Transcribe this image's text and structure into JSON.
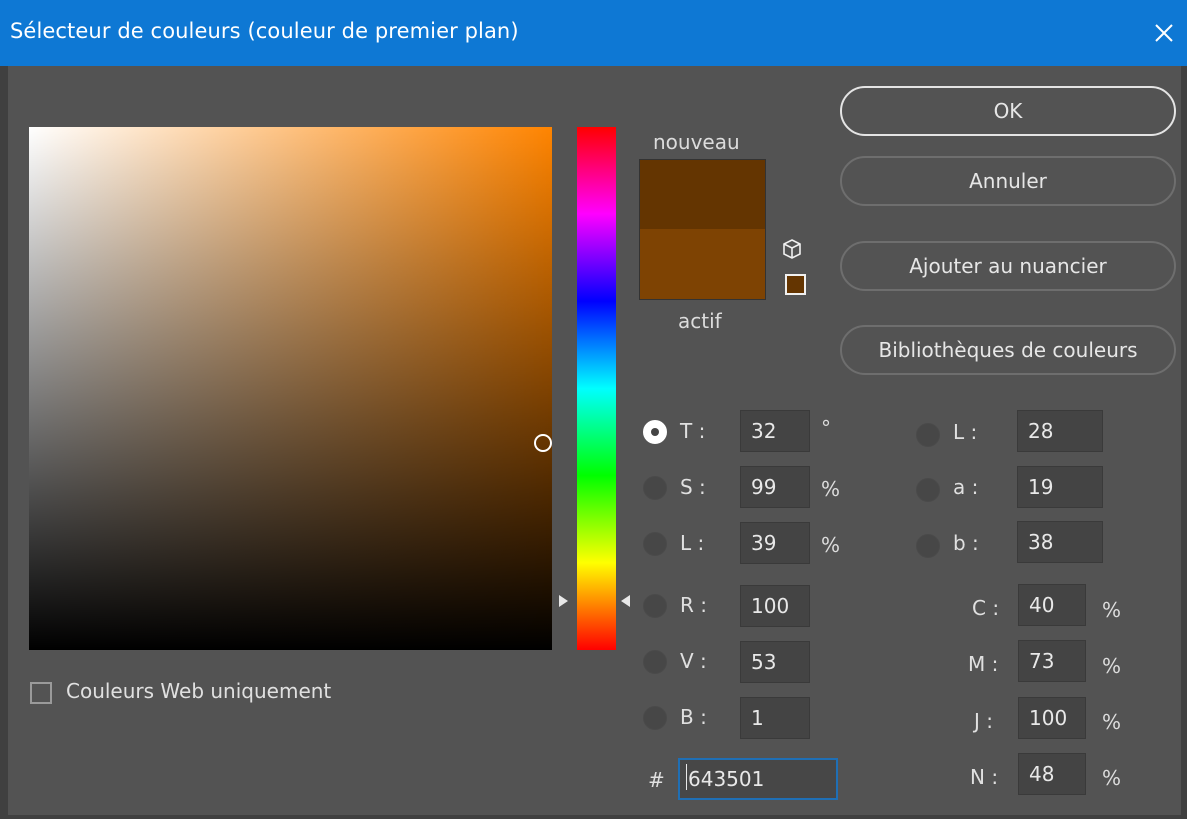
{
  "window": {
    "title": "Sélecteur de couleurs (couleur de premier plan)"
  },
  "buttons": {
    "ok": "OK",
    "cancel": "Annuler",
    "add_swatch": "Ajouter au nuancier",
    "libraries": "Bibliothèques de couleurs"
  },
  "swatch": {
    "new_label": "nouveau",
    "current_label": "actif",
    "new_color": "#643501",
    "current_color": "#7e4303"
  },
  "web_only": {
    "label": "Couleurs Web uniquement",
    "checked": false
  },
  "hsb": {
    "selected": "T",
    "fields": [
      {
        "label": "T :",
        "value": "32",
        "unit": "°"
      },
      {
        "label": "S :",
        "value": "99",
        "unit": "%"
      },
      {
        "label": "L :",
        "value": "39",
        "unit": "%"
      }
    ]
  },
  "rgb": {
    "fields": [
      {
        "label": "R :",
        "value": "100"
      },
      {
        "label": "V :",
        "value": "53"
      },
      {
        "label": "B :",
        "value": "1"
      }
    ]
  },
  "lab": {
    "fields": [
      {
        "label": "L :",
        "value": "28"
      },
      {
        "label": "a :",
        "value": "19"
      },
      {
        "label": "b :",
        "value": "38"
      }
    ]
  },
  "cmyk": {
    "fields": [
      {
        "label": "C :",
        "value": "40",
        "unit": "%"
      },
      {
        "label": "M :",
        "value": "73",
        "unit": "%"
      },
      {
        "label": "J :",
        "value": "100",
        "unit": "%"
      },
      {
        "label": "N :",
        "value": "48",
        "unit": "%"
      }
    ]
  },
  "hex": {
    "prefix": "#",
    "value": "643501"
  },
  "colors": {
    "titlebar": "#0e78d4",
    "field_hue": "#ff8400",
    "focus": "#1f6fb5"
  }
}
